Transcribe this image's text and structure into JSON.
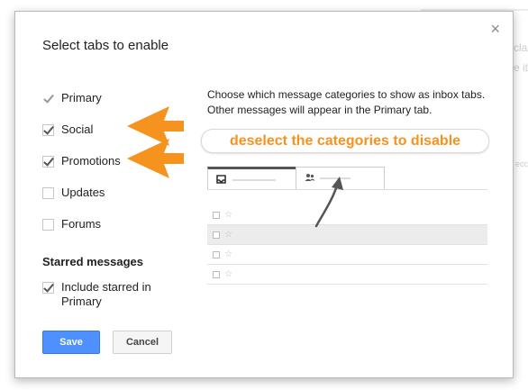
{
  "background": {
    "fragments": [
      "clas",
      "e it",
      "ecc"
    ]
  },
  "dialog": {
    "title": "Select tabs to enable",
    "close_label": "×",
    "options": [
      {
        "label": "Primary",
        "checked": true,
        "disabled": true
      },
      {
        "label": "Social",
        "checked": true,
        "disabled": false
      },
      {
        "label": "Promotions",
        "checked": true,
        "disabled": false
      },
      {
        "label": "Updates",
        "checked": false,
        "disabled": false
      },
      {
        "label": "Forums",
        "checked": false,
        "disabled": false
      }
    ],
    "starred_section_label": "Starred messages",
    "starred_option": {
      "label_line1": "Include starred in",
      "label_line2": "Primary",
      "checked": true
    },
    "save_label": "Save",
    "cancel_label": "Cancel",
    "description": "Choose which message categories to show as inbox tabs. Other messages will appear in the Primary tab.",
    "callout_text": "deselect the categories to disable",
    "preview": {
      "tabs": [
        {
          "icon": "inbox-icon"
        },
        {
          "icon": "people-icon"
        }
      ],
      "rows": [
        {
          "selected": false
        },
        {
          "selected": true
        },
        {
          "selected": false
        },
        {
          "selected": false
        }
      ]
    }
  },
  "colors": {
    "accent_orange": "#f6921e",
    "save_blue": "#4d90fe"
  }
}
